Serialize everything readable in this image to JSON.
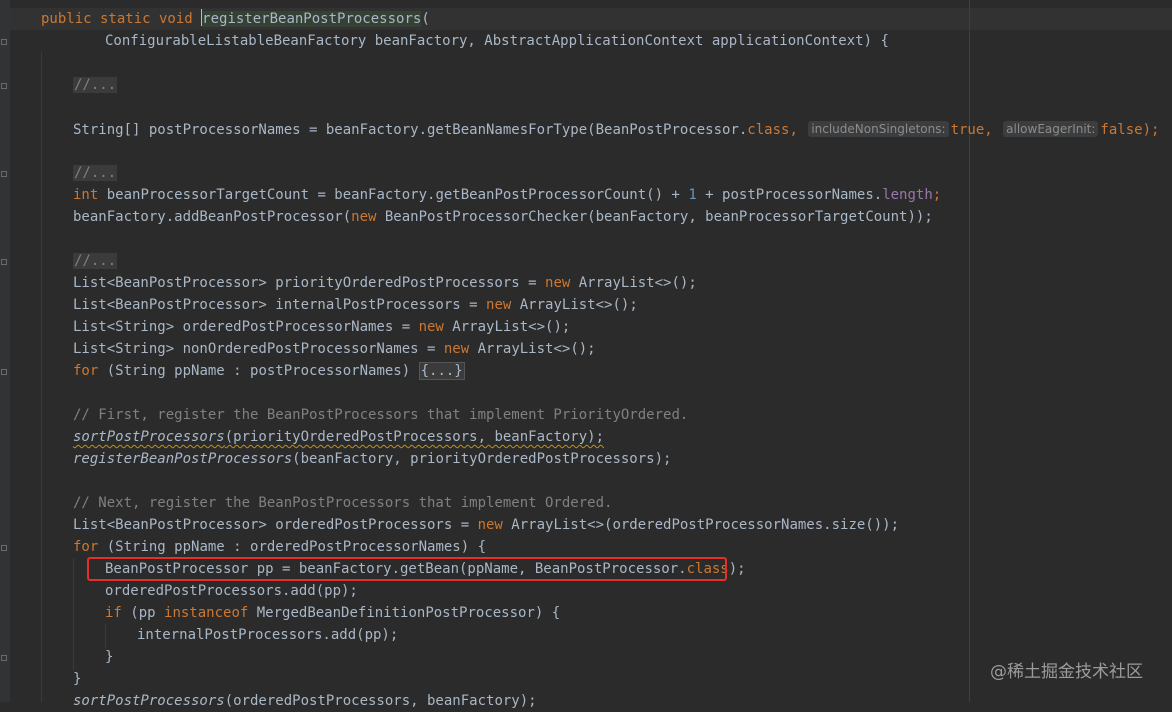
{
  "editor": {
    "lines": {
      "l1": {
        "p1": "public static void ",
        "p2": "registerBeanPostProcessors",
        "p3": "("
      },
      "l2": "ConfigurableListableBeanFactory beanFactory, AbstractApplicationContext applicationContext) {",
      "l3": "//...",
      "l4": {
        "p1": "String[] postProcessorNames = beanFactory.getBeanNamesForType(BeanPostProcessor.",
        "p2": "class",
        "p3": ", ",
        "hint1": "includeNonSingletons:",
        "p4": "true",
        "p5": ", ",
        "hint2": "allowEagerInit:",
        "p6": "false",
        "p7": ");"
      },
      "l5": "//...",
      "l6": {
        "p1": "int",
        "p2": " beanProcessorTargetCount = beanFactory.getBeanPostProcessorCount() + ",
        "p3": "1",
        "p4": " + postProcessorNames.",
        "p5": "length",
        "p6": ";"
      },
      "l7": {
        "p1": "beanFactory.addBeanPostProcessor(",
        "p2": "new",
        "p3": " BeanPostProcessorChecker(beanFactory, beanProcessorTargetCount));"
      },
      "l8": "//...",
      "l9": {
        "p1": "List<BeanPostProcessor> priorityOrderedPostProcessors = ",
        "p2": "new",
        "p3": " ArrayList<>();"
      },
      "l10": {
        "p1": "List<BeanPostProcessor> internalPostProcessors = ",
        "p2": "new",
        "p3": " ArrayList<>();"
      },
      "l11": {
        "p1": "List<String> orderedPostProcessorNames = ",
        "p2": "new",
        "p3": " ArrayList<>();"
      },
      "l12": {
        "p1": "List<String> nonOrderedPostProcessorNames = ",
        "p2": "new",
        "p3": " ArrayList<>();"
      },
      "l13": {
        "p1": "for",
        "p2": " (String ppName : postProcessorNames) ",
        "p3": "{...}"
      },
      "l14": "// First, register the BeanPostProcessors that implement PriorityOrdered.",
      "l15": {
        "p1": "sortPostProcessors",
        "p2": "(priorityOrderedPostProcessors, beanFactory);"
      },
      "l16": {
        "p1": "registerBeanPostProcessors",
        "p2": "(beanFactory, priorityOrderedPostProcessors);"
      },
      "l17": "// Next, register the BeanPostProcessors that implement Ordered.",
      "l18": {
        "p1": "List<BeanPostProcessor> orderedPostProcessors = ",
        "p2": "new",
        "p3": " ArrayList<>(orderedPostProcessorNames.size());"
      },
      "l19": {
        "p1": "for",
        "p2": " (String ppName : orderedPostProcessorNames) {"
      },
      "l20": {
        "p1": "BeanPostProcessor pp = beanFactory.getBean(ppName, BeanPostProcessor.",
        "p2": "class",
        "p3": ");"
      },
      "l21": "orderedPostProcessors.add(pp);",
      "l22": {
        "p1": "if",
        "p2": " (pp ",
        "p3": "instanceof",
        "p4": " MergedBeanDefinitionPostProcessor) {"
      },
      "l23": "internalPostProcessors.add(pp);",
      "l24": "}",
      "l25": "}",
      "l26": {
        "p1": "sortPostProcessors",
        "p2": "(orderedPostProcessors, beanFactory);"
      }
    }
  },
  "watermark": "@稀土掘金技术社区",
  "colors": {
    "background": "#2b2b2b",
    "keyword": "#cc7832",
    "number": "#6897bb",
    "field": "#9876aa",
    "comment": "#808080",
    "text": "#a9b7c6",
    "highlight_box": "#e5302a"
  }
}
